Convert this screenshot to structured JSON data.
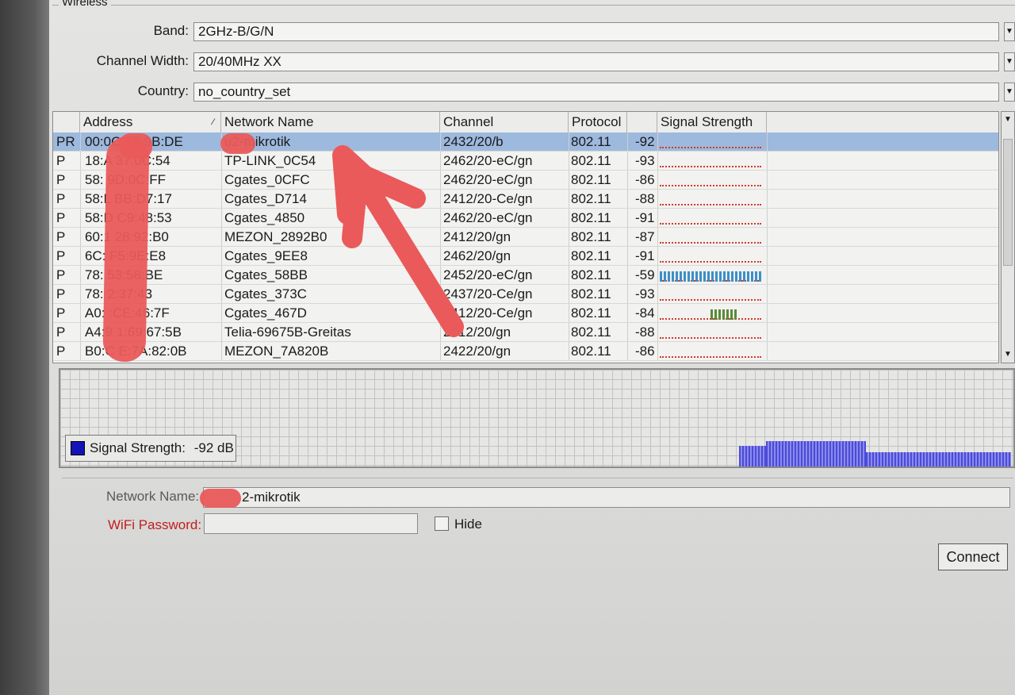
{
  "wireless": {
    "group_title": "Wireless",
    "band_label": "Band:",
    "band_value": "2GHz-B/G/N",
    "width_label": "Channel Width:",
    "width_value": "20/40MHz XX",
    "country_label": "Country:",
    "country_value": "no_country_set"
  },
  "table": {
    "headers": [
      "Address",
      "Network Name",
      "Channel",
      "Protocol",
      "Signal Strength"
    ],
    "rows": [
      {
        "flag": "PR",
        "address": "00:0C  1F:9B:DE",
        "name": "u2-mikrotik",
        "channel": "2432/20/b",
        "protocol": "802.11",
        "signal": "-92",
        "bar": 0.0,
        "bar_color": ""
      },
      {
        "flag": "P",
        "address": "18:A  37:0C:54",
        "name": "TP-LINK_0C54",
        "channel": "2462/20-eC/gn",
        "protocol": "802.11",
        "signal": "-93",
        "bar": 0.0,
        "bar_color": ""
      },
      {
        "flag": "P",
        "address": "58:  9D:0C:FF",
        "name": "Cgates_0CFC",
        "channel": "2462/20-eC/gn",
        "protocol": "802.11",
        "signal": "-86",
        "bar": 0.0,
        "bar_color": ""
      },
      {
        "flag": "P",
        "address": "58:L  BB:D7:17",
        "name": "Cgates_D714",
        "channel": "2412/20-Ce/gn",
        "protocol": "802.11",
        "signal": "-88",
        "bar": 0.0,
        "bar_color": ""
      },
      {
        "flag": "P",
        "address": "58:D  C9:48:53",
        "name": "Cgates_4850",
        "channel": "2462/20-eC/gn",
        "protocol": "802.11",
        "signal": "-91",
        "bar": 0.0,
        "bar_color": ""
      },
      {
        "flag": "P",
        "address": "60:1  28:92:B0",
        "name": "MEZON_2892B0",
        "channel": "2412/20/gn",
        "protocol": "802.11",
        "signal": "-87",
        "bar": 0.0,
        "bar_color": ""
      },
      {
        "flag": "P",
        "address": "6C:  F5:9E:E8",
        "name": "Cgates_9EE8",
        "channel": "2462/20/gn",
        "protocol": "802.11",
        "signal": "-91",
        "bar": 0.0,
        "bar_color": ""
      },
      {
        "flag": "P",
        "address": "78:  53:58:BE",
        "name": "Cgates_58BB",
        "channel": "2452/20-eC/gn",
        "protocol": "802.11",
        "signal": "-59",
        "bar": 1.0,
        "bar_color": "#3d8fc8"
      },
      {
        "flag": "P",
        "address": "78:  2:37:43",
        "name": "Cgates_373C",
        "channel": "2437/20-Ce/gn",
        "protocol": "802.11",
        "signal": "-93",
        "bar": 0.0,
        "bar_color": ""
      },
      {
        "flag": "P",
        "address": "A0:  :CE:46:7F",
        "name": "Cgates_467D",
        "channel": "2412/20-Ce/gn",
        "protocol": "802.11",
        "signal": "-84",
        "bar": 0.26,
        "bar_color": "#5a8a3a"
      },
      {
        "flag": "P",
        "address": "A4:9  1:69:67:5B",
        "name": "Telia-69675B-Greitas",
        "channel": "2412/20/gn",
        "protocol": "802.11",
        "signal": "-88",
        "bar": 0.0,
        "bar_color": ""
      },
      {
        "flag": "P",
        "address": "B0:C  E:7A:82:0B",
        "name": "MEZON_7A820B",
        "channel": "2422/20/gn",
        "protocol": "802.11",
        "signal": "-86",
        "bar": 0.0,
        "bar_color": ""
      }
    ]
  },
  "graph": {
    "legend_label": "Signal Strength:",
    "legend_value": "-92 dB"
  },
  "form": {
    "network_name_label": "Network Name:",
    "network_name_value": "2-mikrotik",
    "password_label": "WiFi Password:",
    "password_value": "",
    "hide_label": "Hide",
    "connect_label": "Connect"
  },
  "colors": {
    "selected_row": "#9db9dd",
    "signal_blue": "#3d8fc8",
    "signal_green": "#5a8a3a",
    "weak_signal_red": "#d23a2a",
    "graph_series": "#1313b8",
    "password_label_red": "#c21e1e",
    "annotation_marker": "#ea5a5a"
  }
}
